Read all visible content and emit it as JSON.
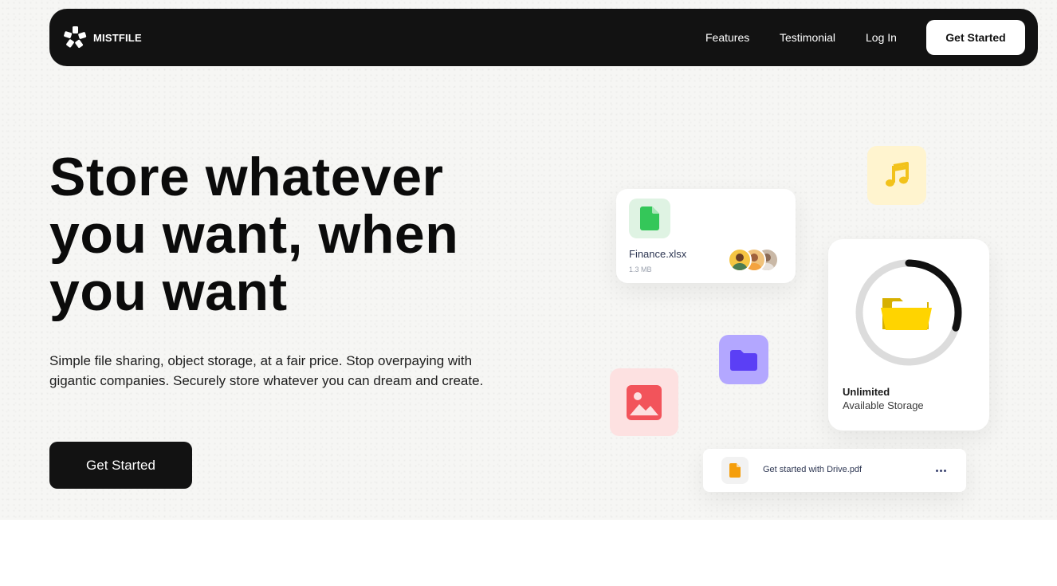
{
  "brand": {
    "name": "MISTFILE",
    "icon": "mistfile-logo-icon"
  },
  "nav": {
    "links": [
      "Features",
      "Testimonial",
      "Log In"
    ],
    "cta": "Get Started"
  },
  "hero": {
    "title": "Store whatever you want, when you want",
    "subtitle": "Simple file sharing, object storage, at a fair price. Stop overpaying with gigantic companies. Securely store whatever you can dream and create.",
    "cta": "Get Started"
  },
  "illustration": {
    "file_card": {
      "name": "Finance.xlsx",
      "size": "1.3 MB",
      "icon": "spreadsheet-file-icon",
      "collaborators": 3
    },
    "music_tile": {
      "icon": "music-note-icon"
    },
    "storage_card": {
      "title": "Unlimited",
      "subtitle": "Available Storage",
      "icon": "open-folder-icon",
      "progress": 0.3
    },
    "folder_tile": {
      "icon": "folder-icon"
    },
    "image_tile": {
      "icon": "image-icon"
    },
    "pdf_card": {
      "name": "Get started with Drive.pdf",
      "icon": "pdf-file-icon",
      "menu_icon": "more-horizontal-icon"
    }
  },
  "colors": {
    "dark": "#121212",
    "green": "#34c759",
    "yellow": "#ffd400",
    "purple": "#5b3ff5",
    "red": "#f2545b",
    "orange": "#f59e0b"
  }
}
